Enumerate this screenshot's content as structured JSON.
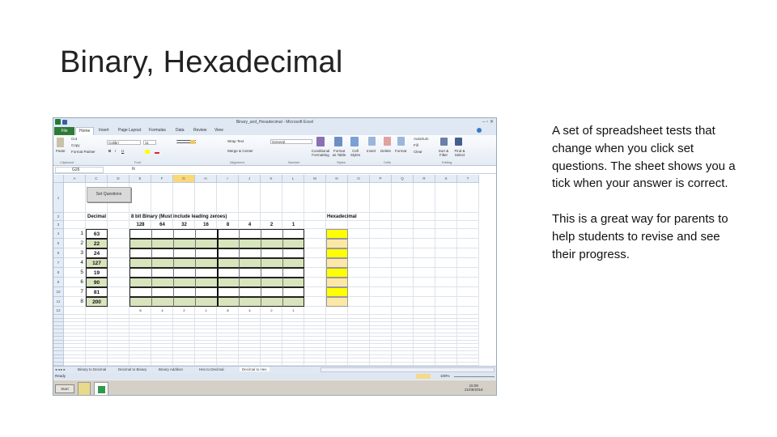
{
  "slide": {
    "title": "Binary, Hexadecimal",
    "paragraphs": [
      "A set of spreadsheet tests that change when you click set questions. The sheet shows you a tick when your answer is correct.",
      "This is a great way for parents to help students to revise and see their progress."
    ]
  },
  "excel": {
    "window_title": "Binary_and_Hexadecimal - Microsoft Excel",
    "tabs": [
      "File",
      "Home",
      "Insert",
      "Page Layout",
      "Formulas",
      "Data",
      "Review",
      "View"
    ],
    "ribbon": {
      "clipboard": [
        "Paste",
        "Cut",
        "Copy",
        "Format Painter"
      ],
      "font_name": "Calibri",
      "font_size": "11",
      "wrap_text": "Wrap Text",
      "merge_center": "Merge & Center",
      "number_format": "General",
      "styles": [
        "Conditional Formatting",
        "Format as Table",
        "Cell Styles"
      ],
      "cells": [
        "Insert",
        "Delete",
        "Format"
      ],
      "editing": [
        "AutoSum",
        "Fill",
        "Clear",
        "Sort & Filter",
        "Find & Select"
      ],
      "groups": [
        "Clipboard",
        "Font",
        "Alignment",
        "Number",
        "Styles",
        "Cells",
        "Editing"
      ]
    },
    "name_box": "G26",
    "fx": "fx",
    "columns": [
      "A",
      "C",
      "D",
      "E",
      "F",
      "G",
      "H",
      "I",
      "J",
      "K",
      "L",
      "M",
      "N",
      "O",
      "P",
      "Q",
      "R",
      "S",
      "T"
    ],
    "selected_column": "G",
    "rows": [
      "1",
      "2",
      "3",
      "4",
      "5",
      "6",
      "7",
      "8",
      "9",
      "10",
      "11",
      "12",
      "13",
      "14",
      "15",
      "16",
      "17",
      "18",
      "19",
      "20",
      "21",
      "22",
      "23",
      "24",
      "25",
      "26"
    ],
    "set_questions_button": "Set Questions",
    "headers": {
      "decimal": "Decimal",
      "binary": "8 bit Binary (Must include leading zeroes)",
      "hex": "Hexadecimal"
    },
    "bit_values": [
      "128",
      "64",
      "32",
      "16",
      "8",
      "4",
      "2",
      "1"
    ],
    "footer_bits": [
      "8",
      "4",
      "2",
      "1",
      "8",
      "4",
      "2",
      "1"
    ],
    "question_numbers": [
      "1",
      "2",
      "3",
      "4",
      "5",
      "6",
      "7",
      "8"
    ],
    "decimals": [
      "63",
      "22",
      "24",
      "127",
      "19",
      "90",
      "81",
      "200"
    ],
    "colors": {
      "green": "#d8e4bc",
      "yellow": "#ffff00",
      "pale_yellow": "#fbe8a8"
    },
    "sheet_tabs": [
      "Binary to Decimal",
      "Decimal to Binary",
      "Binary Addition",
      "Hex to Decimal",
      "Decimal to Hex"
    ],
    "active_sheet": "Decimal to Hex",
    "status": "Ready",
    "zoom": "100%",
    "taskbar": {
      "start": "Start",
      "time": "15:08",
      "date": "21/09/2018"
    }
  }
}
